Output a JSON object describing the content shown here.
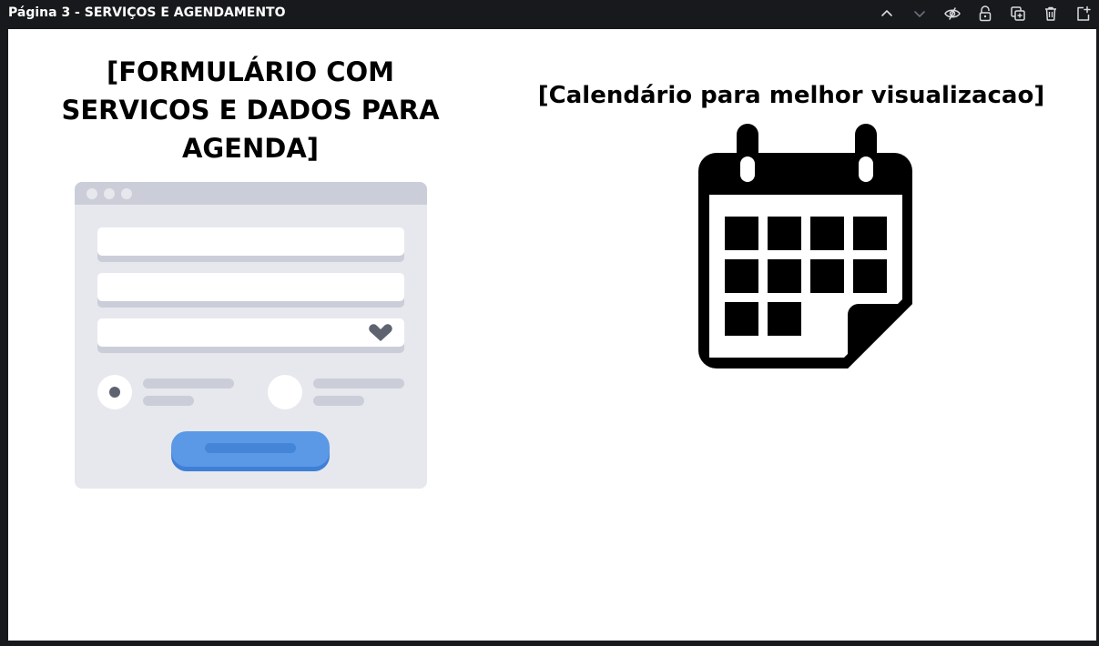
{
  "toolbar": {
    "page_title": "Página 3 - SERVIÇOS E AGENDAMENTO",
    "icons": [
      "chevron-up-icon",
      "chevron-down-icon",
      "hide-icon",
      "unlock-icon",
      "duplicate-icon",
      "trash-icon",
      "add-page-icon"
    ]
  },
  "slide": {
    "heading_left": "[FORMULÁRIO COM SERVICOS E DADOS PARA AGENDA]",
    "heading_right": "[Calendário para melhor visualizacao]",
    "form_illustration": "form-illustration",
    "calendar_icon": "calendar-icon"
  },
  "colors": {
    "toolbar_bg": "#17191c",
    "canvas_bg": "#ffffff",
    "form_bg": "#e6e8ed",
    "form_header": "#cbced8",
    "form_button": "#5b98e6",
    "icon_gray": "#5f6370",
    "calendar": "#000000"
  }
}
